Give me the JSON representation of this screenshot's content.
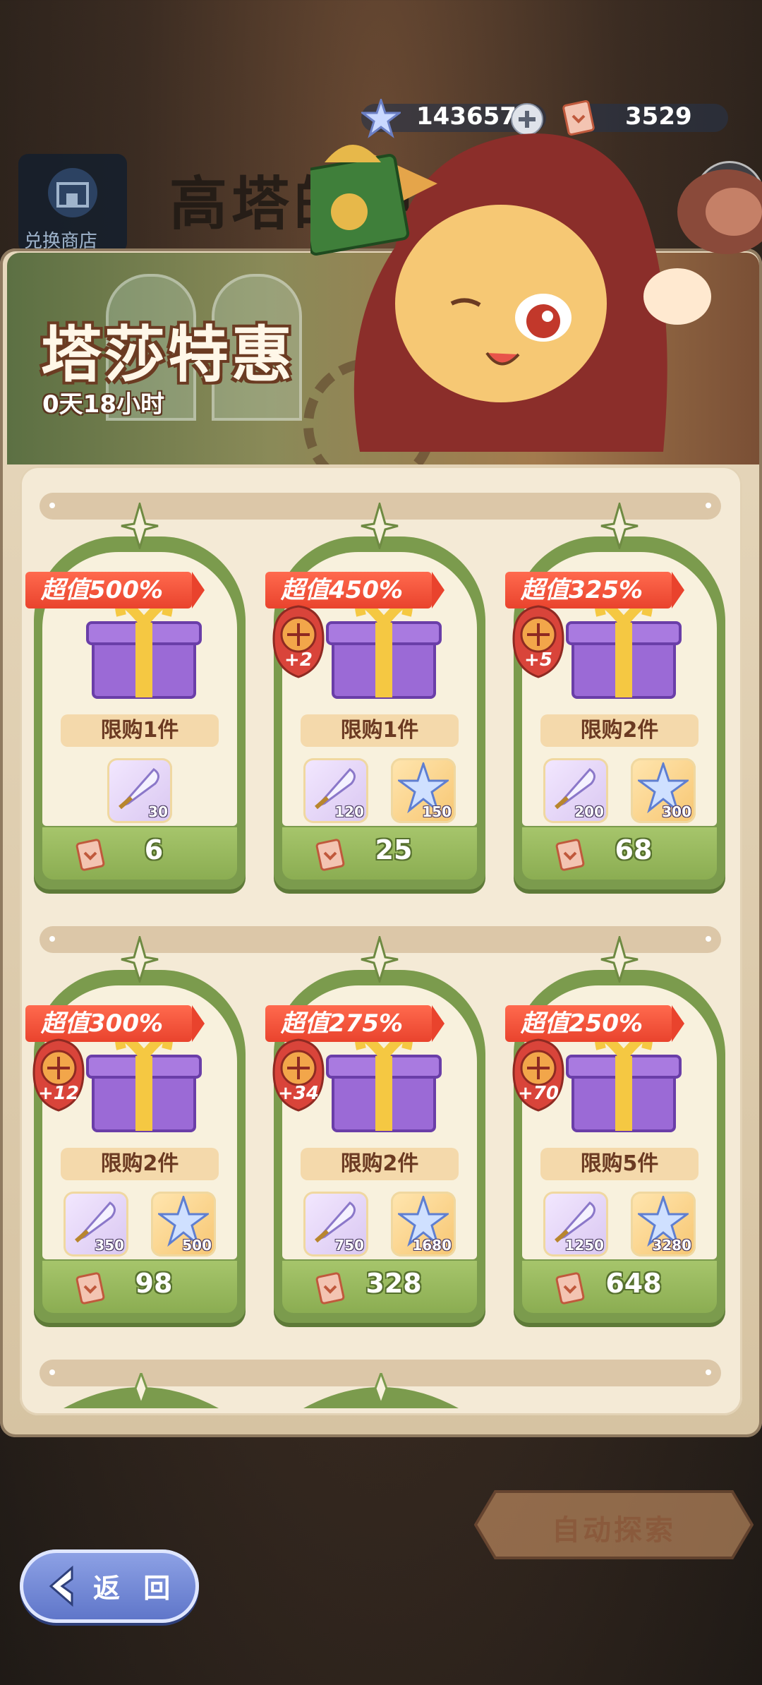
{
  "currency": {
    "gems": "143657",
    "tickets": "3529"
  },
  "shop_title": "高塔的绝密",
  "shop_button_label": "兑换商店",
  "promo": {
    "title": "塔莎特惠",
    "timer": "0天18小时"
  },
  "cards": [
    {
      "ribbon": "超值500%",
      "limit": "限购1件",
      "badge": "",
      "items": [
        {
          "icon": "quill-icon",
          "qty": "30"
        }
      ],
      "price": "6"
    },
    {
      "ribbon": "超值450%",
      "limit": "限购1件",
      "badge": "+2",
      "items": [
        {
          "icon": "quill-icon",
          "qty": "120"
        },
        {
          "icon": "star-crystal-icon",
          "qty": "150"
        }
      ],
      "price": "25"
    },
    {
      "ribbon": "超值325%",
      "limit": "限购2件",
      "badge": "+5",
      "items": [
        {
          "icon": "quill-icon",
          "qty": "200"
        },
        {
          "icon": "star-crystal-icon",
          "qty": "300"
        }
      ],
      "price": "68"
    },
    {
      "ribbon": "超值300%",
      "limit": "限购2件",
      "badge": "+12",
      "items": [
        {
          "icon": "quill-icon",
          "qty": "350"
        },
        {
          "icon": "star-crystal-icon",
          "qty": "500"
        }
      ],
      "price": "98"
    },
    {
      "ribbon": "超值275%",
      "limit": "限购2件",
      "badge": "+34",
      "items": [
        {
          "icon": "quill-icon",
          "qty": "750"
        },
        {
          "icon": "star-crystal-icon",
          "qty": "1680"
        }
      ],
      "price": "328"
    },
    {
      "ribbon": "超值250%",
      "limit": "限购5件",
      "badge": "+70",
      "items": [
        {
          "icon": "quill-icon",
          "qty": "1250"
        },
        {
          "icon": "star-crystal-icon",
          "qty": "3280"
        }
      ],
      "price": "648"
    }
  ],
  "auto_explore_label": "自动探索",
  "back_label": "返 回",
  "colors": {
    "ribbon": "#e9432d",
    "card_green": "#7b9b4d",
    "price_bar": "#8bad52",
    "back_button": "#5d74c8"
  }
}
